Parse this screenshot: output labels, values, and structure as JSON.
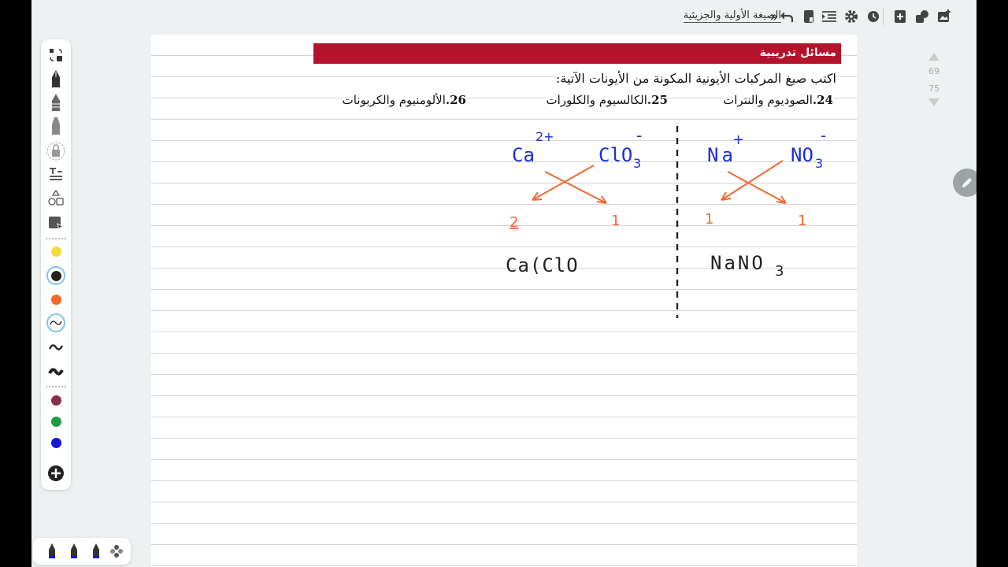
{
  "toolbar": {
    "title": "الصيغة الأولية والجزيئية",
    "breadcrumb_icon": "double-chevron-icon",
    "icons": [
      "undo-icon",
      "bookmark-icon",
      "list-icon",
      "settings-icon",
      "history-icon",
      "add-page-icon",
      "shapes-icon",
      "image-icon"
    ]
  },
  "palette": {
    "tools": [
      "lasso-icon",
      "fountain-pen-icon",
      "pencil-icon",
      "highlighter-icon",
      "eraser-icon",
      "text-icon",
      "shapes-icon",
      "select-icon"
    ],
    "colors": [
      "#f4dc3c",
      "#222222",
      "#f26b2e"
    ],
    "stroke_widths": [
      "thin",
      "medium",
      "thick"
    ],
    "more_colors": [
      "#8b2c4e",
      "#1f9b43",
      "#1616d9"
    ],
    "add_icon": "plus-icon"
  },
  "page": {
    "banner_title": "مسائل تدريبية",
    "instruction": "اكتب صيغ المركبات الأيونية المكونة من الأيونات الآتية:",
    "questions": [
      {
        "num": "24.",
        "text": "الصوديوم والنترات"
      },
      {
        "num": "25.",
        "text": "الكالسيوم والكلورات"
      },
      {
        "num": "26.",
        "text": "الألومنيوم والكربونات"
      }
    ],
    "ink": {
      "right": {
        "cation": "Na",
        "cation_charge": "+",
        "anion": "NO",
        "anion_sub": "3",
        "anion_charge": "-",
        "subs": [
          "1",
          "1"
        ],
        "result": "NaNO",
        "result_sub": "3"
      },
      "left": {
        "cation": "Ca",
        "cation_charge": "2+",
        "anion": "ClO",
        "anion_sub": "3",
        "anion_charge": "-",
        "subs": [
          "2",
          "1"
        ],
        "result": "Ca(ClO"
      }
    }
  },
  "scroller": {
    "prev_page": "69",
    "next_page": "75"
  },
  "colors": {
    "banner": "#b5122b",
    "ink_blue": "#1a2fd6",
    "ink_orange": "#ef6a32",
    "ink_black": "#222222"
  }
}
